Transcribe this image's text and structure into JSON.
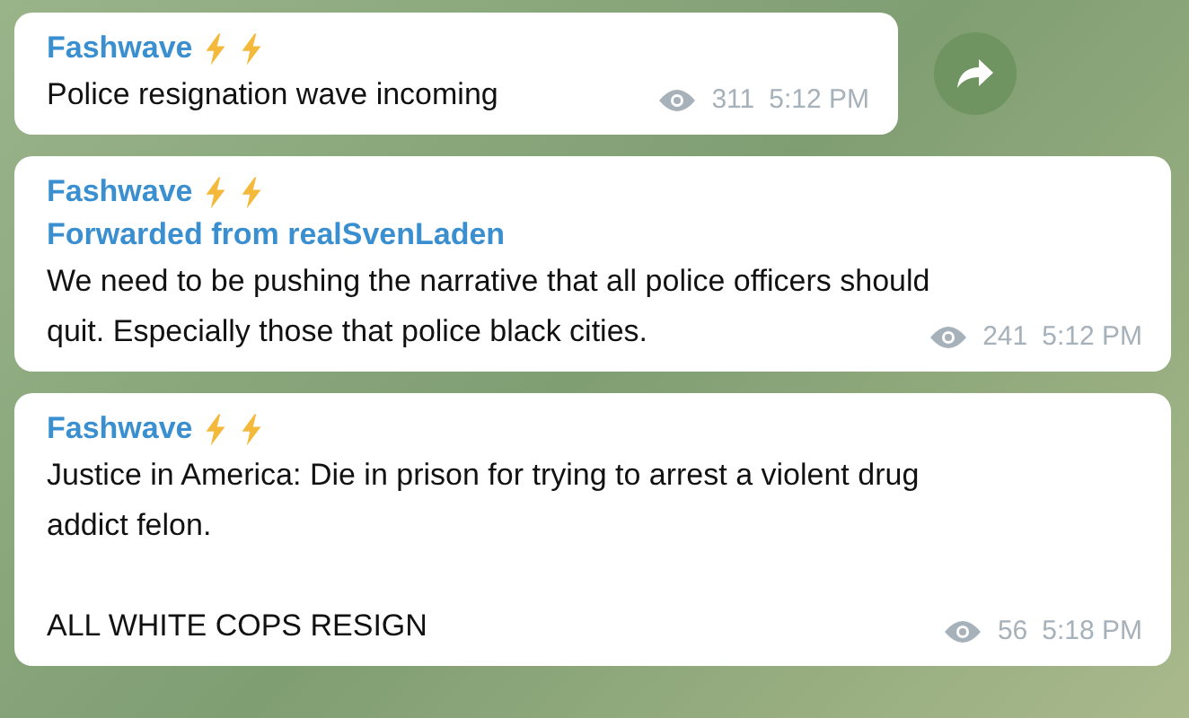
{
  "messages": [
    {
      "sender": "Fashwave",
      "paragraphs": [
        [
          "Police resignation wave incoming"
        ]
      ],
      "views": "311",
      "time": "5:12 PM",
      "share_button": true
    },
    {
      "sender": "Fashwave",
      "forwarded_from": "Forwarded from realSvenLaden",
      "paragraphs": [
        [
          "We need to be pushing the narrative that all police officers should",
          "quit. Especially those that police black cities."
        ]
      ],
      "views": "241",
      "time": "5:12 PM",
      "share_button": false
    },
    {
      "sender": "Fashwave",
      "paragraphs": [
        [
          "Justice in America: Die in prison for trying to arrest a violent drug",
          "addict felon."
        ],
        [
          "ALL WHITE COPS RESIGN"
        ]
      ],
      "views": "56",
      "time": "5:18 PM",
      "share_button": false
    }
  ]
}
